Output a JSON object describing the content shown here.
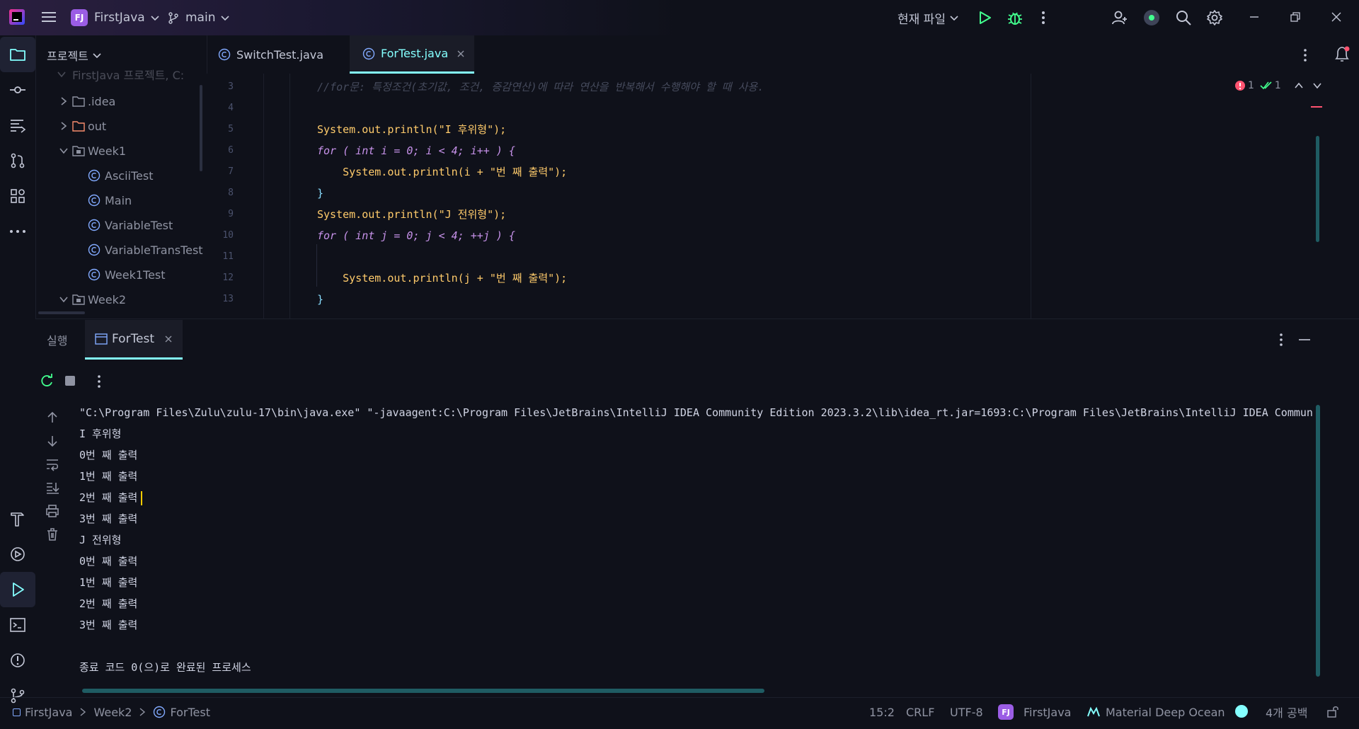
{
  "titlebar": {
    "project_initials": "FJ",
    "project_name": "FirstJava",
    "branch": "main",
    "run_config": "현재 파일"
  },
  "project_panel": {
    "title": "프로젝트",
    "tree": [
      {
        "label": "FirstJava 프로젝트, C:",
        "type": "root"
      },
      {
        "label": ".idea",
        "type": "folder"
      },
      {
        "label": "out",
        "type": "folder-out"
      },
      {
        "label": "Week1",
        "type": "module"
      },
      {
        "label": "AsciiTest",
        "type": "class"
      },
      {
        "label": "Main",
        "type": "class"
      },
      {
        "label": "VariableTest",
        "type": "class"
      },
      {
        "label": "VariableTransTest",
        "type": "class"
      },
      {
        "label": "Week1Test",
        "type": "class"
      },
      {
        "label": "Week2",
        "type": "module"
      }
    ]
  },
  "editor": {
    "tabs": [
      {
        "label": "SwitchTest.java",
        "active": false
      },
      {
        "label": "ForTest.java",
        "active": true
      }
    ],
    "inspection": {
      "errors": "1",
      "warnings": "1"
    },
    "lines": [
      {
        "n": "3",
        "text": "//for문: 특정조건(초기값, 조건, 증감연산)에 따라 연산을 반복해서 수행해야 할 때 사용."
      },
      {
        "n": "4",
        "text": ""
      },
      {
        "n": "5",
        "text": "System.out.println(\"I 후위형\");"
      },
      {
        "n": "6",
        "text": "for ( int i = 0; i < 4; i++ ) {"
      },
      {
        "n": "7",
        "text": "    System.out.println(i + \"번 째 출력\");"
      },
      {
        "n": "8",
        "text": "}"
      },
      {
        "n": "9",
        "text": "System.out.println(\"J 전위형\");"
      },
      {
        "n": "10",
        "text": "for ( int j = 0; j < 4; ++j ) {"
      },
      {
        "n": "11",
        "text": ""
      },
      {
        "n": "12",
        "text": "    System.out.println(j + \"번 째 출력\");"
      },
      {
        "n": "13",
        "text": "}"
      }
    ]
  },
  "run_panel": {
    "tab_run": "실행",
    "tab_active": "ForTest",
    "output": [
      "\"C:\\Program Files\\Zulu\\zulu-17\\bin\\java.exe\" \"-javaagent:C:\\Program Files\\JetBrains\\IntelliJ IDEA Community Edition 2023.3.2\\lib\\idea_rt.jar=1693:C:\\Program Files\\JetBrains\\IntelliJ IDEA Communi",
      "I 후위형",
      "0번 째 출력",
      "1번 째 출력",
      "2번 째 출력",
      "3번 째 출력",
      "J 전위형",
      "0번 째 출력",
      "1번 째 출력",
      "2번 째 출력",
      "3번 째 출력",
      "",
      "종료 코드 0(으)로 완료된 프로세스"
    ]
  },
  "statusbar": {
    "breadcrumb": [
      "FirstJava",
      "Week2",
      "ForTest"
    ],
    "position": "15:2",
    "line_sep": "CRLF",
    "encoding": "UTF-8",
    "project_initials": "FJ",
    "project": "FirstJava",
    "theme": "Material Deep Ocean",
    "indent": "4개 공백"
  },
  "colors": {
    "accent": "#84ffff",
    "background": "#0f111a",
    "project_badge": "#9b5de5",
    "error": "#ff5370"
  }
}
